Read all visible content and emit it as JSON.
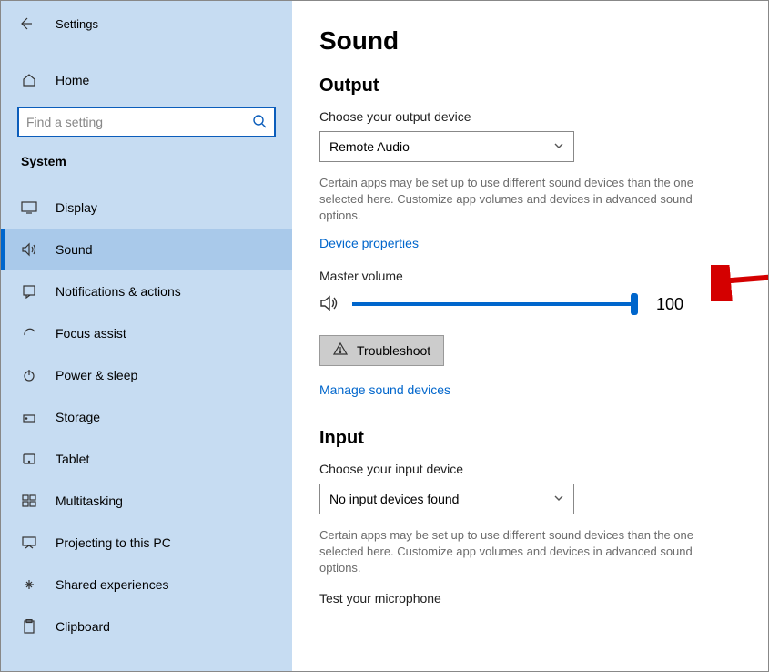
{
  "header": {
    "app_title": "Settings"
  },
  "sidebar": {
    "home_label": "Home",
    "search_placeholder": "Find a setting",
    "category": "System",
    "items": [
      {
        "label": "Display"
      },
      {
        "label": "Sound"
      },
      {
        "label": "Notifications & actions"
      },
      {
        "label": "Focus assist"
      },
      {
        "label": "Power & sleep"
      },
      {
        "label": "Storage"
      },
      {
        "label": "Tablet"
      },
      {
        "label": "Multitasking"
      },
      {
        "label": "Projecting to this PC"
      },
      {
        "label": "Shared experiences"
      },
      {
        "label": "Clipboard"
      }
    ]
  },
  "main": {
    "title": "Sound",
    "output": {
      "heading": "Output",
      "choose_label": "Choose your output device",
      "selected": "Remote Audio",
      "description": "Certain apps may be set up to use different sound devices than the one selected here. Customize app volumes and devices in advanced sound options.",
      "device_properties_link": "Device properties",
      "master_volume_label": "Master volume",
      "volume_value": "100",
      "troubleshoot_label": "Troubleshoot",
      "manage_link": "Manage sound devices"
    },
    "input": {
      "heading": "Input",
      "choose_label": "Choose your input device",
      "selected": "No input devices found",
      "description": "Certain apps may be set up to use different sound devices than the one selected here. Customize app volumes and devices in advanced sound options.",
      "mic_test_label": "Test your microphone"
    }
  }
}
